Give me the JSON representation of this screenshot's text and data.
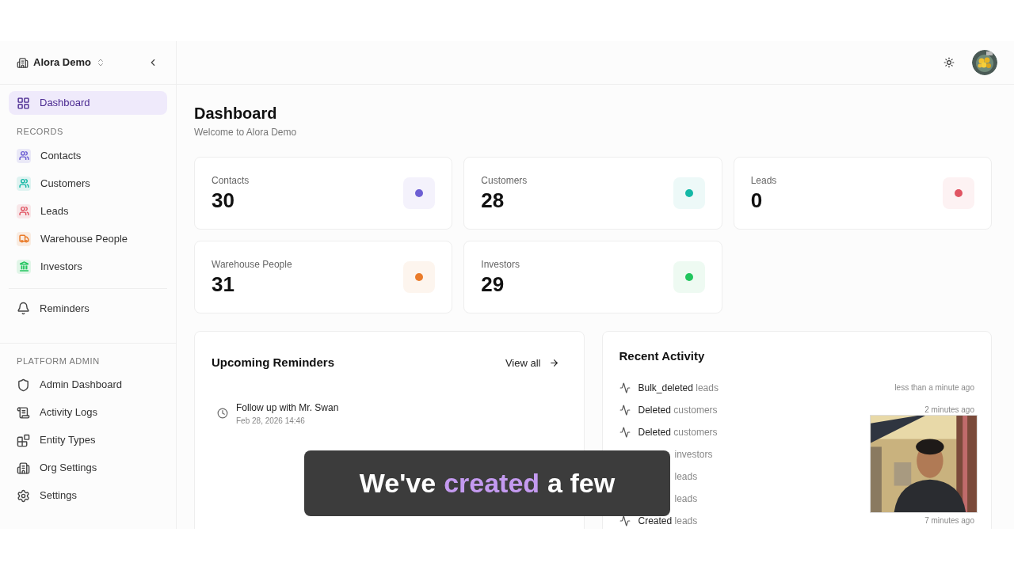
{
  "sidebar": {
    "org": "Alora Demo",
    "main_items": [
      {
        "label": "Dashboard",
        "selected": true
      }
    ],
    "records_heading": "RECORDS",
    "records": [
      {
        "label": "Contacts",
        "selected": false,
        "color": "#6d5fd3"
      },
      {
        "label": "Customers",
        "selected": false,
        "color": "#14b8a6"
      },
      {
        "label": "Leads",
        "selected": false,
        "color": "#e05563"
      },
      {
        "label": "Warehouse People",
        "selected": false,
        "color": "#ea7c2b"
      },
      {
        "label": "Investors",
        "selected": false,
        "color": "#22c55e"
      }
    ],
    "reminders_item": {
      "label": "Reminders",
      "selected": false
    },
    "admin_heading": "PLATFORM ADMIN",
    "admin_items": [
      {
        "label": "Admin Dashboard",
        "selected": false
      },
      {
        "label": "Activity Logs",
        "selected": false
      },
      {
        "label": "Entity Types",
        "selected": false
      },
      {
        "label": "Org Settings",
        "selected": false
      },
      {
        "label": "Settings",
        "selected": false
      }
    ]
  },
  "page": {
    "title": "Dashboard",
    "subtitle": "Welcome to Alora Demo"
  },
  "stats": [
    {
      "label": "Contacts",
      "value": "30",
      "color": "#6d5fd3"
    },
    {
      "label": "Customers",
      "value": "28",
      "color": "#14b8a6"
    },
    {
      "label": "Leads",
      "value": "0",
      "color": "#e05563"
    },
    {
      "label": "Warehouse People",
      "value": "31",
      "color": "#ea7c2b"
    },
    {
      "label": "Investors",
      "value": "29",
      "color": "#22c55e"
    }
  ],
  "reminders": {
    "title": "Upcoming Reminders",
    "link": "View all",
    "items": [
      {
        "title": "Follow up with Mr. Swan",
        "when": "Feb 28, 2026 14:46"
      }
    ]
  },
  "activity": {
    "title": "Recent Activity",
    "items": [
      {
        "action": "Bulk_deleted",
        "entity": "leads",
        "time": "less than a minute ago"
      },
      {
        "action": "Deleted",
        "entity": "customers",
        "time": "2 minutes ago"
      },
      {
        "action": "Deleted",
        "entity": "customers"
      },
      {
        "entity": "investors"
      },
      {
        "entity": "leads"
      },
      {
        "entity": "leads"
      },
      {
        "action": "Created",
        "entity": "leads",
        "time": "7 minutes ago"
      }
    ]
  },
  "caption": {
    "parts": [
      {
        "text": "We've",
        "highlighted": false
      },
      {
        "text": "created",
        "highlighted": true
      },
      {
        "text": "a few",
        "highlighted": false
      }
    ]
  }
}
